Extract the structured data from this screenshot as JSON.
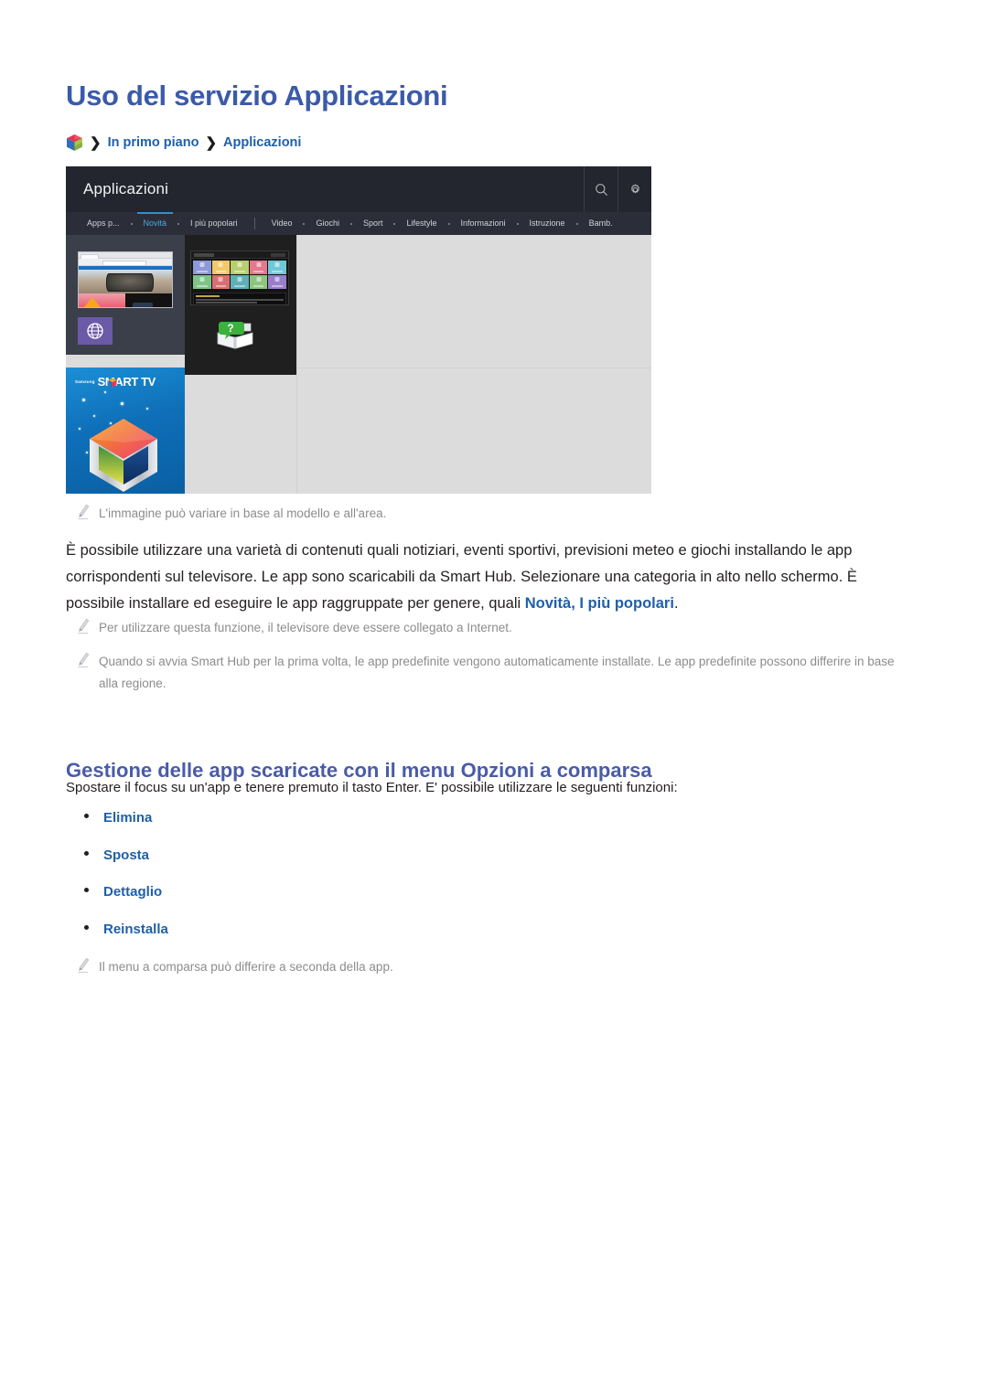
{
  "document": {
    "page_title": "Uso del servizio Applicazioni",
    "breadcrumb": {
      "icon": "smart-hub-cube-icon",
      "separator": "❯",
      "items": [
        "In primo piano",
        "Applicazioni"
      ]
    },
    "accent_color": "#3b5ba9",
    "link_color": "#2060a8",
    "note_color": "#8c8c8c"
  },
  "tv_screenshot": {
    "header": {
      "title": "Applicazioni",
      "background": "#23262f",
      "icons": [
        "search-icon",
        "gear-icon"
      ]
    },
    "tabs": [
      {
        "label": "Apps p...",
        "active": false
      },
      {
        "label": "Novità",
        "active": true
      },
      {
        "label": "I più popolari",
        "active": false
      },
      {
        "label": "Video",
        "active": false
      },
      {
        "label": "Giochi",
        "active": false
      },
      {
        "label": "Sport",
        "active": false
      },
      {
        "label": "Lifestyle",
        "active": false
      },
      {
        "label": "Informazioni",
        "active": false
      },
      {
        "label": "Istruzione",
        "active": false
      },
      {
        "label": "Bamb.",
        "active": false
      }
    ],
    "active_tab_color": "#4aa8e0",
    "tiles": [
      {
        "name": "web-browser-tile",
        "icon": "globe-icon",
        "icon_color": "#6a5aa8"
      },
      {
        "name": "e-manual-tile",
        "icon": "question-book-icon",
        "icon_color": "#3db13d"
      },
      {
        "name": "smart-tv-promo-tile",
        "brand": "Samsung",
        "brand_product": "SMART TV"
      }
    ],
    "content_background": "#dcdcdc"
  },
  "notes": {
    "image_variation": "L'immagine può variare in base al modello e all'area.",
    "internet_required": "Per utilizzare questa funzione, il televisore deve essere collegato a Internet.",
    "default_apps": "Quando si avvia Smart Hub per la prima volta, le app predefinite vengono automaticamente installate. Le app predefinite possono differire in base alla regione.",
    "popup_menu_varies": "Il menu a comparsa può differire a seconda della app."
  },
  "body": {
    "paragraph_1_part_1": "È possibile utilizzare una varietà di contenuti quali notiziari, eventi sportivi, previsioni meteo e giochi installando le app corrispondenti sul televisore. Le app sono scaricabili da Smart Hub. Selezionare una categoria in alto nello schermo. È possibile installare ed eseguire le app raggruppate per genere, quali ",
    "paragraph_1_highlight": "Novità, I più popolari",
    "paragraph_1_part_2": "."
  },
  "section_2": {
    "heading": "Gestione delle app scaricate con il menu Opzioni a comparsa",
    "lead": "Spostare il focus su un'app e tenere premuto il tasto Enter. E' possibile utilizzare le seguenti funzioni:",
    "options": [
      {
        "label": "Elimina"
      },
      {
        "label": "Sposta"
      },
      {
        "label": "Dettaglio"
      },
      {
        "label": "Reinstalla"
      }
    ]
  }
}
